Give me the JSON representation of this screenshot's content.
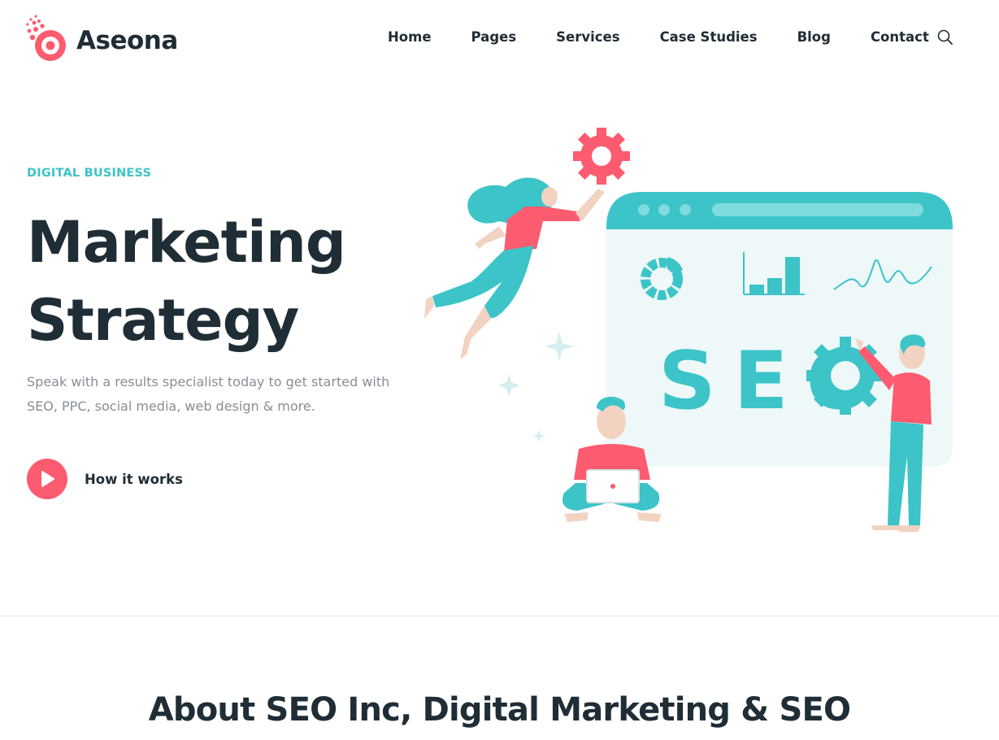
{
  "brand": {
    "name": "Aseona",
    "accent": "#fd5b6f",
    "teal": "#3cc4c8",
    "dark": "#1f2d36"
  },
  "nav": {
    "items": [
      {
        "label": "Home"
      },
      {
        "label": "Pages"
      },
      {
        "label": "Services"
      },
      {
        "label": "Case Studies"
      },
      {
        "label": "Blog"
      },
      {
        "label": "Contact"
      }
    ],
    "search_icon": "search-icon"
  },
  "hero": {
    "eyebrow": "DIGITAL BUSINESS",
    "title_line1": "Marketing",
    "title_line2": "Strategy",
    "description": "Speak with a results specialist today to get started with SEO, PPC, social media, web design & more.",
    "cta_label": "How it works",
    "cta_icon": "play-icon",
    "illustration": {
      "browser_text": "SEO"
    }
  },
  "about": {
    "title": "About SEO Inc, Digital Marketing & SEO"
  }
}
